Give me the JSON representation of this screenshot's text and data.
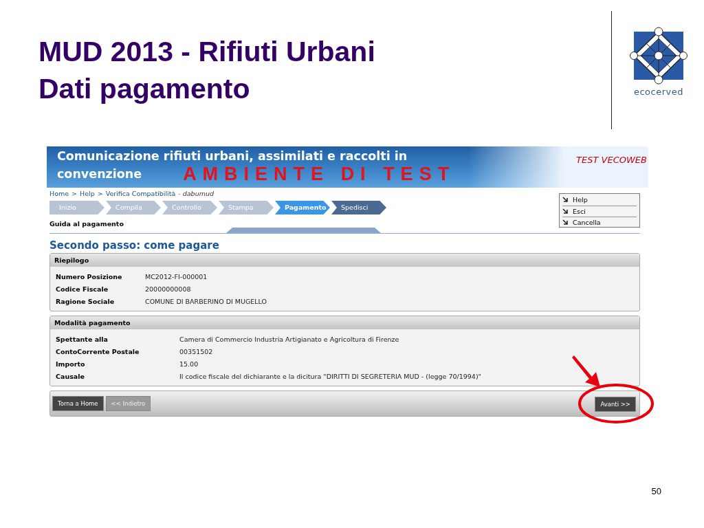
{
  "slide": {
    "title_lines": [
      "MUD 2013 - Rifiuti Urbani",
      "Dati pagamento"
    ],
    "logo_text": "ecocerved",
    "page_number": "50"
  },
  "app": {
    "banner": {
      "title_lines": [
        "Comunicazione rifiuti urbani, assimilati e raccolti in",
        "convenzione"
      ],
      "overlay": "AMBIENTE DI TEST",
      "environment": "TEST VECOWEB"
    },
    "breadcrumb": {
      "links": [
        "Home",
        "Help",
        "Verifica Compatibilità"
      ],
      "separator": ">",
      "current": "- dabumud"
    },
    "steps": [
      {
        "label": "Inizio",
        "selected": false,
        "kind": "done"
      },
      {
        "label": "Compila",
        "selected": false,
        "kind": "done"
      },
      {
        "label": "Controllo",
        "selected": false,
        "kind": "done"
      },
      {
        "label": "Stampa",
        "selected": false,
        "kind": "done"
      },
      {
        "label": "Pagamento",
        "selected": true,
        "kind": "done"
      },
      {
        "label": "Spedisci",
        "selected": false,
        "kind": "pending"
      }
    ],
    "side_menu": [
      "Help",
      "Esci",
      "Cancella"
    ],
    "guide_label": "Guida al pagamento",
    "heading": "Secondo passo: come pagare",
    "panels": [
      {
        "title": "Riepilogo",
        "rows": [
          {
            "label": "Numero Posizione",
            "value": "MC2012-FI-000001"
          },
          {
            "label": "Codice Fiscale",
            "value": "20000000008"
          },
          {
            "label": "Ragione Sociale",
            "value": "COMUNE DI BARBERINO DI MUGELLO"
          }
        ]
      },
      {
        "title": "Modalità pagamento",
        "rows": [
          {
            "label": "Spettante alla",
            "value": "Camera di Commercio Industria Artigianato e Agricoltura di Firenze"
          },
          {
            "label": "ContoCorrente Postale",
            "value": "00351502"
          },
          {
            "label": "Importo",
            "value": "15.00"
          },
          {
            "label": "Causale",
            "value": "Il codice fiscale del dichiarante e la dicitura \"DIRITTI DI SEGRETERIA MUD - (legge 70/1994)\""
          }
        ]
      }
    ],
    "left_buttons": [
      {
        "label": "Torna a Home",
        "disabled": false
      },
      {
        "label": "<< Indietro",
        "disabled": true
      }
    ],
    "next_button": {
      "label": "Avanti >>",
      "highlighted": true
    }
  }
}
